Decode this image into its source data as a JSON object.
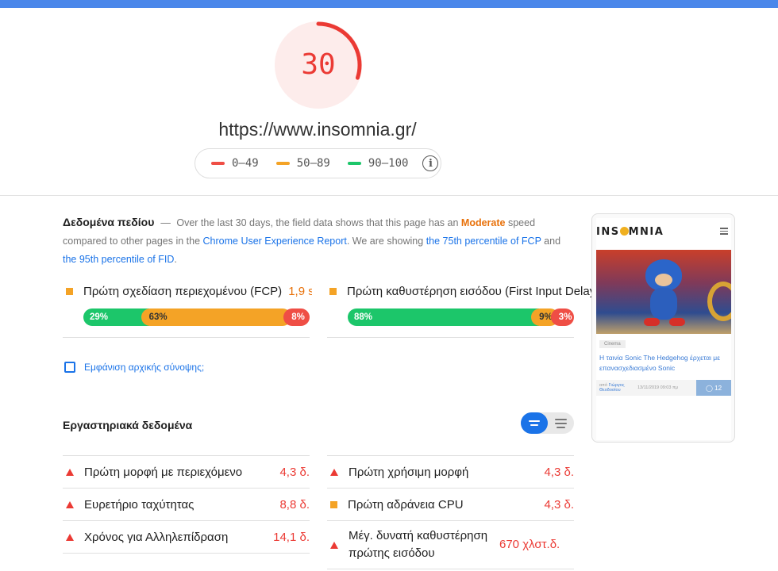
{
  "score": {
    "value": "30",
    "fraction": 0.3,
    "color": "#eb3a34"
  },
  "url": "https://www.insomnia.gr/",
  "legend": {
    "items": [
      {
        "label": "0–49",
        "color": "#ef4e45"
      },
      {
        "label": "50–89",
        "color": "#f4a326"
      },
      {
        "label": "90–100",
        "color": "#1cc66a"
      }
    ],
    "info_icon": "info-icon"
  },
  "field": {
    "title": "Δεδομένα πεδίου",
    "dash": "—",
    "text_1": "Over the last 30 days, the field data shows that this page has an",
    "rating": "Moderate",
    "text_2": "speed compared to other pages in the",
    "link_1": "Chrome User Experience Report",
    "text_3": ". We are showing",
    "link_2": "the 75th percentile of FCP",
    "text_4": "and",
    "link_3": "the 95th percentile of FID",
    "text_5": ".",
    "metrics": [
      {
        "label": "Πρώτη σχεδίαση περιεχομένου (FCP)",
        "value": "1,9 s",
        "distribution": [
          {
            "label": "29%",
            "fraction": 0.29
          },
          {
            "label": "63%",
            "fraction": 0.63
          },
          {
            "label": "8%",
            "fraction": 0.08
          }
        ]
      },
      {
        "label": "Πρώτη καθυστέρηση εισόδου (First Input Delay",
        "value": "",
        "distribution": [
          {
            "label": "88%",
            "fraction": 0.88
          },
          {
            "label": "9%",
            "fraction": 0.09
          },
          {
            "label": "3%",
            "fraction": 0.03
          }
        ]
      }
    ]
  },
  "origin_summary": {
    "label": "Εμφάνιση αρχικής σύνοψης;",
    "checked": false
  },
  "lab": {
    "title": "Εργαστηριακά δεδομένα",
    "rows_left": [
      {
        "label": "Πρώτη μορφή με περιεχόμενο",
        "value": "4,3 δ.",
        "status": "fail"
      },
      {
        "label": "Ευρετήριο ταχύτητας",
        "value": "8,8 δ.",
        "status": "fail"
      },
      {
        "label": "Χρόνος για Αλληλεπίδραση",
        "value": "14,1 δ.",
        "status": "fail"
      }
    ],
    "rows_right": [
      {
        "label": "Πρώτη χρήσιμη μορφή",
        "value": "4,3 δ.",
        "status": "fail"
      },
      {
        "label": "Πρώτη αδράνεια CPU",
        "value": "4,3 δ.",
        "status": "average"
      },
      {
        "label": "Μέγ. δυνατή καθυστέρηση πρώτης εισόδου",
        "value": "670 χλστ.δ.",
        "status": "fail"
      }
    ]
  },
  "preview": {
    "logo_left": "INS",
    "logo_right": "MNIA",
    "tag": "Cinema",
    "headline": "Η ταινία Sonic The Hedgehog έρχεται με επανασχεδιασμένο Sonic",
    "author_prefix": "από",
    "author": "Γιώργος Θεοδοσίου",
    "date": "13/11/2019 09:03 πμ",
    "comments": "12"
  },
  "colors": {
    "accent": "#1a73e8",
    "top_bar": "#4a87ea",
    "fail": "#eb3a34",
    "average": "#f4a326",
    "pass": "#1cc66a"
  }
}
